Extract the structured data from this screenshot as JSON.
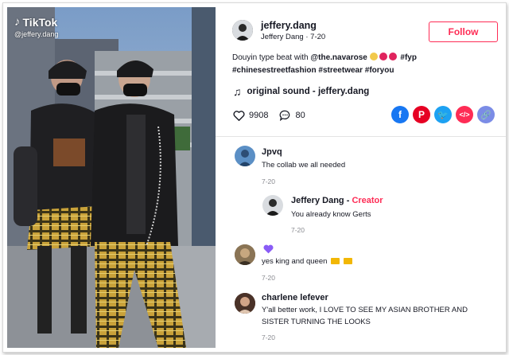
{
  "video": {
    "logo_text": "TikTok",
    "handle": "@jeffery.dang"
  },
  "post": {
    "username": "jeffery.dang",
    "display_name": "Jeffery Dang",
    "date": "7-20",
    "follow_label": "Follow",
    "caption_text": "Douyin type beat with ",
    "caption_mention": "@the.navarose",
    "caption_tags": [
      "#fyp",
      "#chinesestreetfashion",
      "#streetwear",
      "#foryou"
    ],
    "sound": "original sound - jeffery.dang",
    "likes": "9908",
    "comments": "80"
  },
  "comments": [
    {
      "name": "Jpvq",
      "text": "The collab we all needed",
      "date": "7-20"
    },
    {
      "name": "Jeffery Dang",
      "badge": "Creator",
      "text": "You already know Gerts",
      "date": "7-20"
    },
    {
      "name": "",
      "text": "yes king and queen",
      "date": "7-20"
    },
    {
      "name": "charlene lefever",
      "text": "Y'all better work, I LOVE TO SEE MY ASIAN BROTHER AND SISTER TURNING THE LOOKS",
      "date": "7-20"
    }
  ],
  "colors": {
    "accent": "#fe2c55",
    "text": "#161823",
    "muted": "#8a8b91"
  }
}
